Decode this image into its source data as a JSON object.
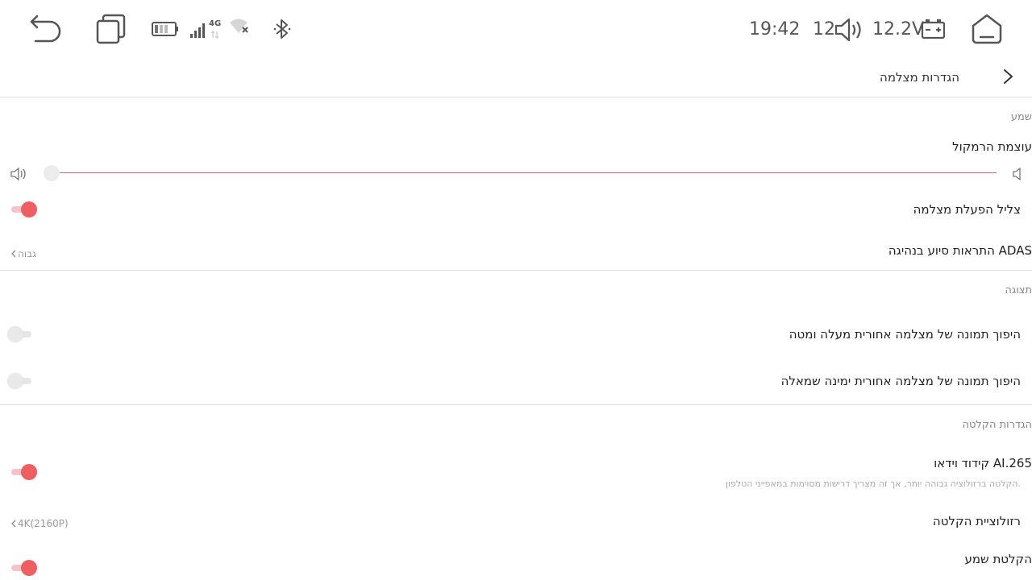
{
  "status_bar": {
    "time": "19:42",
    "volume_level": "12",
    "voltage": "12.2V",
    "network_type": "4G",
    "icons": [
      "back-icon",
      "recent-apps-icon",
      "battery-icon",
      "cellular-signal-icon",
      "wifi-off-icon",
      "bluetooth-icon",
      "volume-icon",
      "car-battery-icon",
      "home-icon"
    ]
  },
  "header": {
    "title": "הגדרות מצלמה"
  },
  "colors": {
    "accent": "#ee5f64",
    "slider_line": "#c86a70",
    "divider": "#dddddd"
  },
  "sections": {
    "audio": {
      "title": "שמע",
      "speaker_volume_label": "עוצמת הרמקול",
      "speaker_volume_value": 0,
      "camera_startup_sound_label": "צליל הפעלת מצלמה",
      "camera_startup_sound_on": true,
      "adas_alerts_label": "התראות סיוע בנהיגה ADAS",
      "adas_alerts_value": "גבוה"
    },
    "display": {
      "title": "תצוגה",
      "flip_vertical_label": "היפוך תמונה של מצלמה אחורית מעלה ומטה",
      "flip_vertical_on": false,
      "flip_horizontal_label": "היפוך תמונה של מצלמה אחורית ימינה שמאלה",
      "flip_horizontal_on": false
    },
    "recording": {
      "title": "הגדרות הקלטה",
      "h265_label": "קידוד וידאו AI.265",
      "h265_hint": "הקלטה ברזולוציה גבוהה יותר, אך זה מצריך דרישות מסוימות במאפייני הטלפון.",
      "h265_on": true,
      "resolution_label": "רזולוציית הקלטה",
      "resolution_value": "4K(2160P)",
      "audio_recording_label": "הקלטת שמע",
      "audio_recording_on": true
    }
  }
}
